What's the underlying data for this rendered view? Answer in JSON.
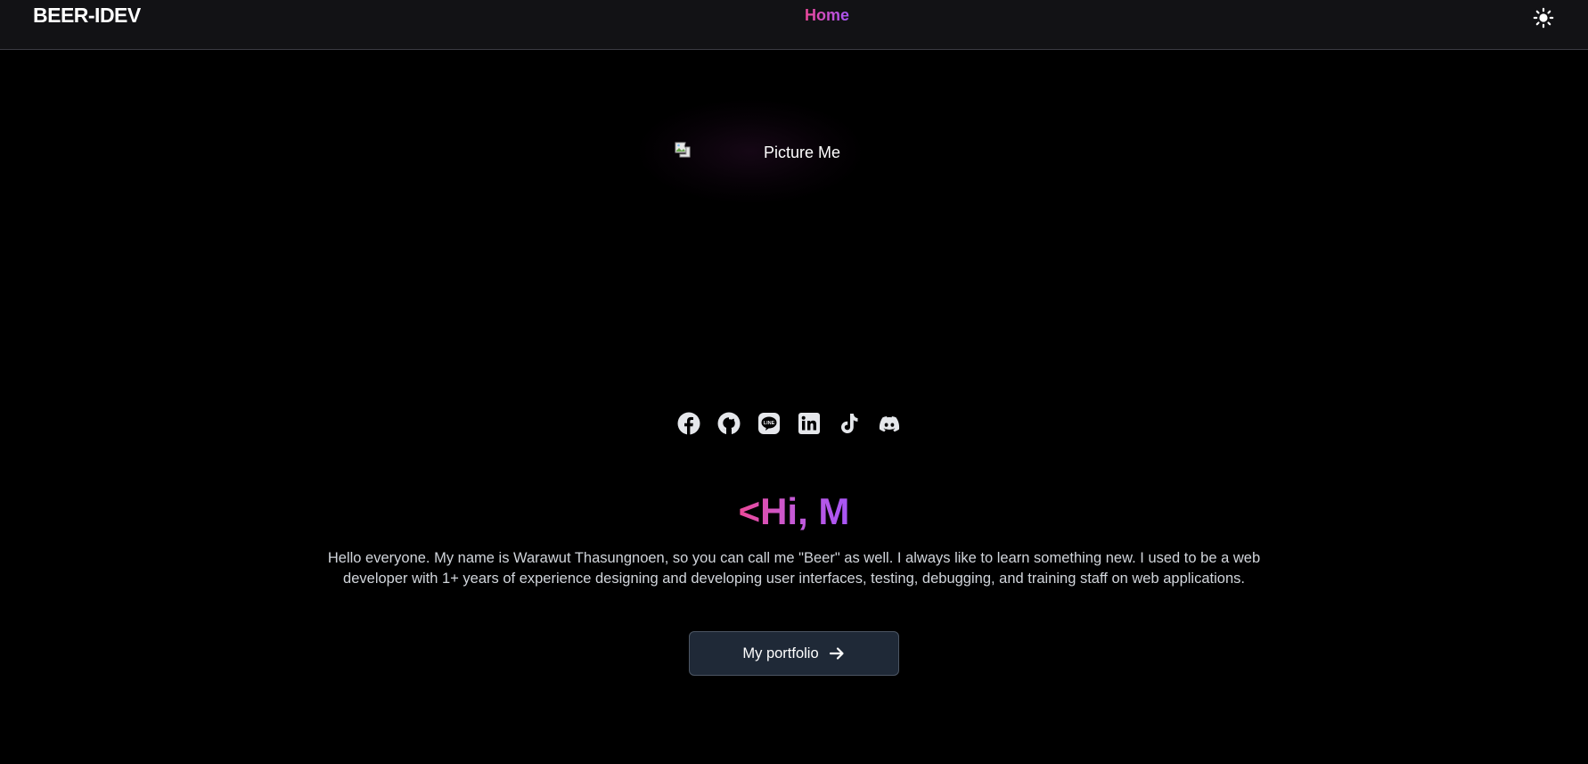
{
  "navbar": {
    "brand": "BEER-IDEV",
    "home_label": "Home",
    "theme_icon": "sun-icon"
  },
  "hero": {
    "image_alt": "Picture Me",
    "broken_image_icon": "broken-image-icon"
  },
  "socials": [
    {
      "icon": "facebook-icon"
    },
    {
      "icon": "github-icon"
    },
    {
      "icon": "line-icon"
    },
    {
      "icon": "linkedin-icon"
    },
    {
      "icon": "tiktok-icon"
    },
    {
      "icon": "discord-icon"
    }
  ],
  "greeting": "<Hi, M",
  "intro": "Hello everyone. My name is Warawut Thasungnoen, so you can call me \"Beer\" as well. I always like to learn something new. I used to be a web developer with 1+ years of experience designing and developing user interfaces, testing, debugging, and training staff on web applications.",
  "cta": {
    "label": "My portfolio",
    "icon": "arrow-right-icon"
  },
  "colors": {
    "accent_pink": "#ec4899",
    "accent_purple": "#a855f7",
    "background": "#000000",
    "navbar_bg": "#121215",
    "button_bg": "#1f2937"
  }
}
